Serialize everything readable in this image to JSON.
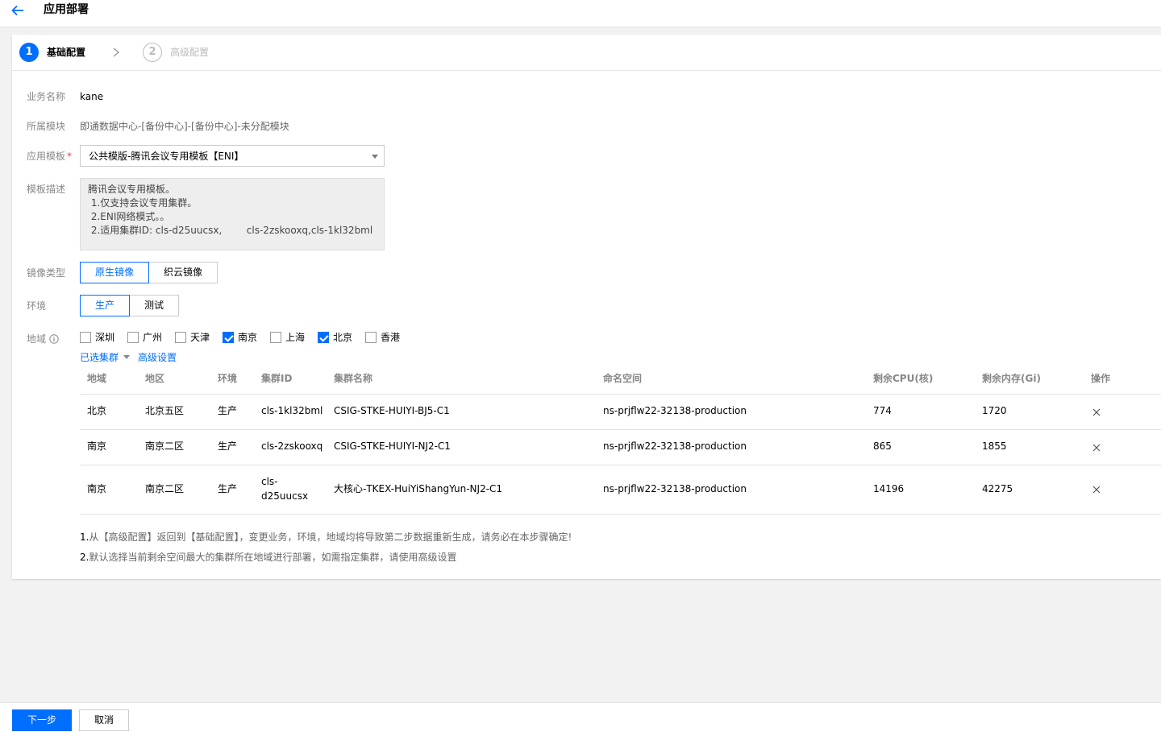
{
  "header": {
    "title": "应用部署"
  },
  "steps": [
    {
      "number": "1",
      "label": "基础配置",
      "active": true
    },
    {
      "number": "2",
      "label": "高级配置",
      "active": false
    }
  ],
  "form": {
    "business_label": "业务名称",
    "business_value": "kane",
    "module_label": "所属模块",
    "module_value": "即通数据中心-[备份中心]-[备份中心]-未分配模块",
    "template_label": "应用模板",
    "template_required": "*",
    "template_value": "公共模版-腾讯会议专用模板【ENI】",
    "desc_label": "模板描述",
    "desc_lines": [
      "腾讯会议专用模板。",
      " 1.仅支持会议专用集群。",
      " 2.ENI网络模式。。",
      " 2.适用集群ID: cls-d25uucsx,        cls-2zskooxq,cls-1kl32bml"
    ],
    "image_label": "镜像类型",
    "image_options": [
      "原生镜像",
      "织云镜像"
    ],
    "image_selected": "原生镜像",
    "env_label": "环境",
    "env_options": [
      "生产",
      "测试"
    ],
    "env_selected": "生产",
    "region_label": "地域",
    "regions": [
      {
        "name": "深圳",
        "checked": false
      },
      {
        "name": "广州",
        "checked": false
      },
      {
        "name": "天津",
        "checked": false
      },
      {
        "name": "南京",
        "checked": true
      },
      {
        "name": "上海",
        "checked": false
      },
      {
        "name": "北京",
        "checked": true
      },
      {
        "name": "香港",
        "checked": false
      }
    ],
    "selected_clusters_link": "已选集群",
    "advanced_link": "高级设置"
  },
  "table": {
    "columns": [
      "地域",
      "地区",
      "环境",
      "集群ID",
      "集群名称",
      "命名空间",
      "剩余CPU(核)",
      "剩余内存(Gi)",
      "操作"
    ],
    "rows": [
      {
        "region": "北京",
        "zone": "北京五区",
        "env": "生产",
        "cluster_id": "cls-1kl32bml",
        "cluster_name": "CSIG-STKE-HUIYI-BJ5-C1",
        "namespace": "ns-prjflw22-32138-production",
        "cpu": "774",
        "mem": "1720"
      },
      {
        "region": "南京",
        "zone": "南京二区",
        "env": "生产",
        "cluster_id": "cls-2zskooxq",
        "cluster_name": "CSIG-STKE-HUIYI-NJ2-C1",
        "namespace": "ns-prjflw22-32138-production",
        "cpu": "865",
        "mem": "1855"
      },
      {
        "region": "南京",
        "zone": "南京二区",
        "env": "生产",
        "cluster_id_line1": "cls-",
        "cluster_id_line2": "d25uucsx",
        "cluster_name": "大核心-TKEX-HuiYiShangYun-NJ2-C1",
        "namespace": "ns-prjflw22-32138-production",
        "cpu": "14196",
        "mem": "42275"
      }
    ]
  },
  "notes": [
    {
      "num": "1.",
      "text": "从【高级配置】返回到【基础配置】，变更业务，环境，地域均将导致第二步数据重新生成，请务必在本步骤确定!"
    },
    {
      "num": "2.",
      "text": "默认选择当前剩余空间最大的集群所在地域进行部署，如需指定集群，请使用高级设置"
    }
  ],
  "footer": {
    "next_label": "下一步",
    "cancel_label": "取消"
  },
  "colors": {
    "primary": "#006eff",
    "required": "#e54545"
  }
}
